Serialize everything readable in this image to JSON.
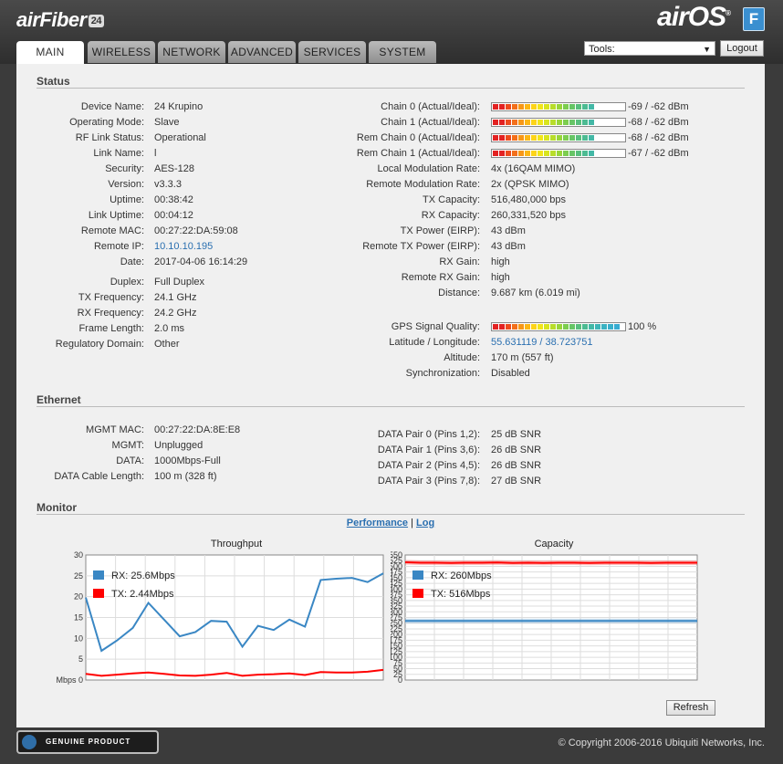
{
  "header": {
    "brand": "airFiber",
    "brand_badge": "24",
    "os": "airOS",
    "os_badge": "F"
  },
  "tabs": [
    "MAIN",
    "WIRELESS",
    "NETWORK",
    "ADVANCED",
    "SERVICES",
    "SYSTEM"
  ],
  "tools": {
    "label": "Tools:"
  },
  "logout_label": "Logout",
  "status": {
    "title": "Status",
    "left": [
      {
        "label": "Device Name:",
        "value": "24 Krupino"
      },
      {
        "label": "Operating Mode:",
        "value": "Slave"
      },
      {
        "label": "RF Link Status:",
        "value": "Operational"
      },
      {
        "label": "Link Name:",
        "value": "l"
      },
      {
        "label": "Security:",
        "value": "AES-128"
      },
      {
        "label": "Version:",
        "value": "v3.3.3"
      },
      {
        "label": "Uptime:",
        "value": "00:38:42"
      },
      {
        "label": "Link Uptime:",
        "value": "00:04:12"
      },
      {
        "label": "Remote MAC:",
        "value": "00:27:22:DA:59:08"
      },
      {
        "label": "Remote IP:",
        "value": "10.10.10.195"
      },
      {
        "label": "Date:",
        "value": "2017-04-06 16:14:29"
      }
    ],
    "left2": [
      {
        "label": "Duplex:",
        "value": "Full Duplex"
      },
      {
        "label": "TX Frequency:",
        "value": "24.1 GHz"
      },
      {
        "label": "RX Frequency:",
        "value": "24.2 GHz"
      },
      {
        "label": "Frame Length:",
        "value": "2.0 ms"
      },
      {
        "label": "Regulatory Domain:",
        "value": "Other"
      }
    ],
    "chains": [
      {
        "label": "Chain 0 (Actual/Ideal):",
        "value": "-69 / -62 dBm",
        "level": 0.78
      },
      {
        "label": "Chain 1 (Actual/Ideal):",
        "value": "-68 / -62 dBm",
        "level": 0.8
      },
      {
        "label": "Rem Chain 0 (Actual/Ideal):",
        "value": "-68 / -62 dBm",
        "level": 0.8
      },
      {
        "label": "Rem Chain 1 (Actual/Ideal):",
        "value": "-67 / -62 dBm",
        "level": 0.82
      }
    ],
    "right": [
      {
        "label": "Local Modulation Rate:",
        "value": "4x (16QAM MIMO)"
      },
      {
        "label": "Remote Modulation Rate:",
        "value": "2x (QPSK MIMO)"
      },
      {
        "label": "TX Capacity:",
        "value": "516,480,000 bps"
      },
      {
        "label": "RX Capacity:",
        "value": "260,331,520 bps"
      },
      {
        "label": "TX Power (EIRP):",
        "value": "43 dBm"
      },
      {
        "label": "Remote TX Power (EIRP):",
        "value": "43 dBm"
      },
      {
        "label": "RX Gain:",
        "value": "high"
      },
      {
        "label": "Remote RX Gain:",
        "value": "high"
      },
      {
        "label": "Distance:",
        "value": "9.687 km (6.019 mi)"
      }
    ],
    "gps": {
      "label": "GPS Signal Quality:",
      "value": "100 %",
      "level": 1.0
    },
    "right2": [
      {
        "label": "Latitude / Longitude:",
        "value": "55.631119 / 38.723751"
      },
      {
        "label": "Altitude:",
        "value": "170 m (557 ft)"
      },
      {
        "label": "Synchronization:",
        "value": "Disabled"
      }
    ]
  },
  "ethernet": {
    "title": "Ethernet",
    "left": [
      {
        "label": "MGMT MAC:",
        "value": "00:27:22:DA:8E:E8"
      },
      {
        "label": "MGMT:",
        "value": "Unplugged"
      },
      {
        "label": "DATA:",
        "value": "1000Mbps-Full"
      },
      {
        "label": "DATA Cable Length:",
        "value": "100 m (328 ft)"
      }
    ],
    "right": [
      {
        "label": "DATA Pair 0 (Pins 1,2):",
        "value": "25 dB SNR"
      },
      {
        "label": "DATA Pair 1 (Pins 3,6):",
        "value": "26 dB SNR"
      },
      {
        "label": "DATA Pair 2 (Pins 4,5):",
        "value": "26 dB SNR"
      },
      {
        "label": "DATA Pair 3 (Pins 7,8):",
        "value": "27 dB SNR"
      }
    ]
  },
  "monitor": {
    "title": "Monitor",
    "performance": "Performance",
    "separator": "|",
    "log": "Log",
    "refresh": "Refresh"
  },
  "colors": {
    "rx": "#3a87c4",
    "tx": "#ff0000"
  },
  "chart_data": [
    {
      "type": "line",
      "title": "Throughput",
      "ylabel_unit": "Mbps",
      "ylim": [
        0,
        30
      ],
      "yticks": [
        0,
        5,
        10,
        15,
        20,
        25,
        30
      ],
      "x": [
        0,
        1,
        2,
        3,
        4,
        5,
        6,
        7,
        8,
        9,
        10,
        11,
        12,
        13,
        14,
        15,
        16,
        17,
        18
      ],
      "series": [
        {
          "name": "RX: 25.6Mbps",
          "color": "#3a87c4",
          "values": [
            19.8,
            7,
            9.5,
            12.5,
            18.5,
            14.5,
            10.5,
            11.5,
            14.2,
            14,
            8,
            13,
            12,
            14.5,
            12.8,
            24,
            24.3,
            24.5,
            23.5,
            25.6
          ]
        },
        {
          "name": "TX: 2.44Mbps",
          "color": "#ff0000",
          "values": [
            1.5,
            1,
            1.3,
            1.6,
            1.8,
            1.5,
            1.1,
            1.0,
            1.3,
            1.7,
            1.0,
            1.3,
            1.4,
            1.6,
            1.2,
            1.9,
            1.8,
            1.8,
            2.0,
            2.44
          ]
        }
      ],
      "grid": true,
      "legend": "top-left"
    },
    {
      "type": "line",
      "title": "Capacity",
      "ylim": [
        0,
        550
      ],
      "yticks": [
        0,
        25,
        50,
        75,
        100,
        125,
        150,
        175,
        200,
        225,
        250,
        275,
        300,
        325,
        350,
        375,
        400,
        425,
        450,
        475,
        500,
        525,
        550
      ],
      "series": [
        {
          "name": "RX: 260Mbps",
          "color": "#3a87c4",
          "values": [
            260,
            260,
            260,
            260,
            260,
            260,
            260,
            260,
            260,
            260,
            260,
            260,
            260,
            260,
            260,
            260,
            260,
            260,
            260,
            260
          ]
        },
        {
          "name": "TX: 516Mbps",
          "color": "#ff0000",
          "values": [
            518,
            516,
            516,
            515,
            516,
            516,
            517,
            515,
            516,
            515,
            516,
            516,
            515,
            516,
            516,
            516,
            515,
            516,
            516,
            516
          ]
        }
      ],
      "grid": true,
      "legend": "top-left"
    }
  ],
  "footer": {
    "genuine": "GENUINE PRODUCT",
    "copyright": "© Copyright 2006-2016 Ubiquiti Networks, Inc."
  }
}
